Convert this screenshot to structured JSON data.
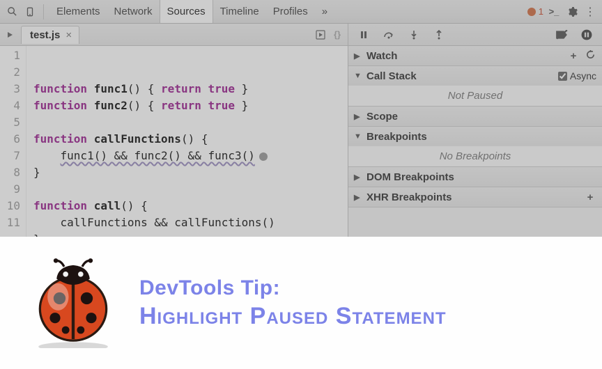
{
  "toolbar": {
    "tabs": [
      "Elements",
      "Network",
      "Sources",
      "Timeline",
      "Profiles"
    ],
    "active_tab_index": 2,
    "overflow_glyph": "»",
    "error_count": "1"
  },
  "file_tab": {
    "name": "test.js",
    "close_glyph": "×"
  },
  "code_lines": [
    "",
    "function func1() { return true }",
    "function func2() { return true }",
    "",
    "function callFunctions() {",
    "    func1() && func2() && func3()",
    "}",
    "",
    "function call() {",
    "    callFunctions && callFunctions()",
    "}"
  ],
  "debugger": {
    "sections": {
      "watch": {
        "title": "Watch"
      },
      "callstack": {
        "title": "Call Stack",
        "body": "Not Paused",
        "async_label": "Async"
      },
      "scope": {
        "title": "Scope"
      },
      "breakpoints": {
        "title": "Breakpoints",
        "body": "No Breakpoints"
      },
      "dom": {
        "title": "DOM Breakpoints"
      },
      "xhr": {
        "title": "XHR Breakpoints"
      }
    }
  },
  "banner": {
    "line1": "DevTools Tip:",
    "line2": "Highlight Paused Statement"
  }
}
